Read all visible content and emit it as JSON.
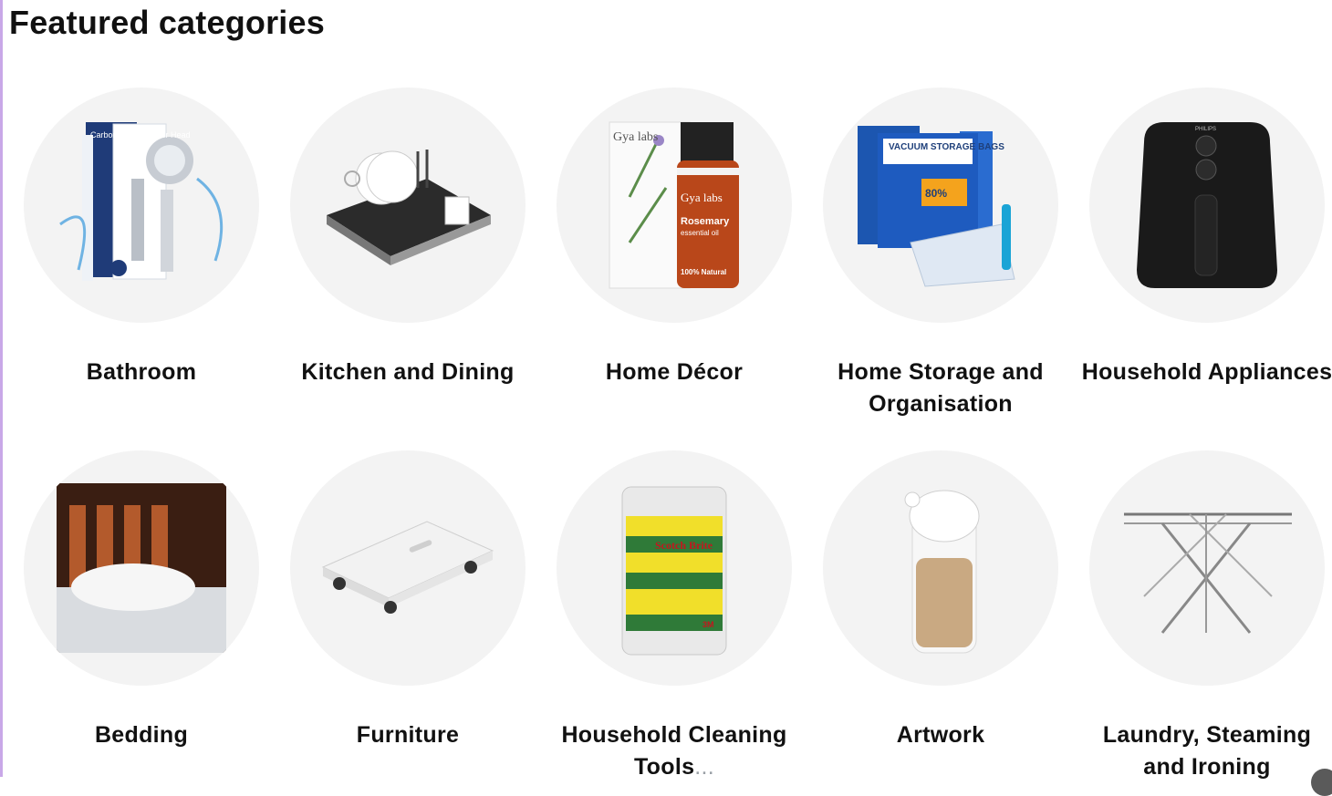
{
  "page": {
    "title": "Featured categories"
  },
  "categories": [
    {
      "label": "Bathroom",
      "icon": "shower-head-icon"
    },
    {
      "label": "Kitchen and Dining",
      "icon": "dish-rack-icon"
    },
    {
      "label": "Home Décor",
      "icon": "essential-oil-icon"
    },
    {
      "label": "Home Storage and Organisation",
      "icon": "vacuum-bags-icon"
    },
    {
      "label": "Household Appliances",
      "icon": "air-fryer-icon"
    },
    {
      "label": "Bedding",
      "icon": "pillow-icon"
    },
    {
      "label": "Furniture",
      "icon": "dolly-icon"
    },
    {
      "label": "Household Cleaning Tools",
      "ellipsis": "...",
      "icon": "sponge-pack-icon"
    },
    {
      "label": "Artwork",
      "icon": "jar-icon"
    },
    {
      "label": "Laundry, Steaming and Ironing",
      "icon": "drying-rack-icon"
    }
  ],
  "product_text": {
    "shower_box": "Carbon Fiber Shower Head",
    "oil_brand": "Gya labs",
    "oil_name": "Rosemary",
    "oil_sub": "essential oil",
    "oil_badge": "100% Natural",
    "vacuum_title": "VACUUM STORAGE BAGS",
    "vacuum_badge": "80%",
    "fryer_brand": "PHILIPS",
    "sponge_brand": "Scotch Brite",
    "sponge_logo": "3M"
  }
}
